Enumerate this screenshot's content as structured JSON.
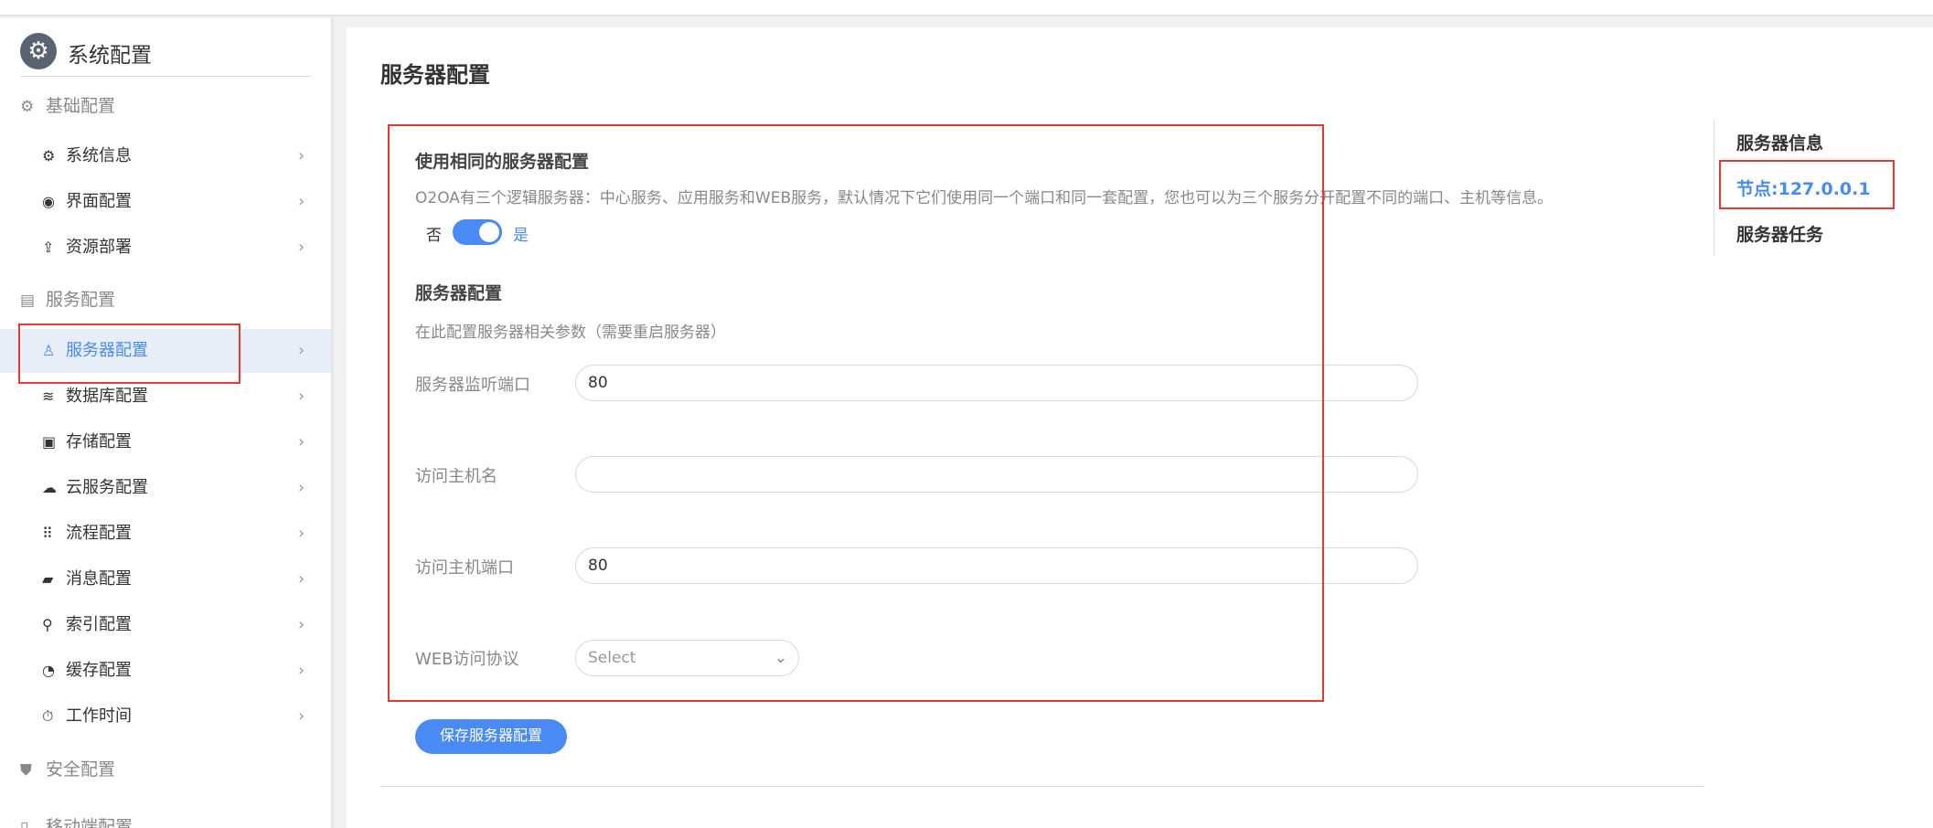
{
  "sidebar": {
    "title": "系统配置",
    "groups": {
      "basic": "基础配置",
      "service": "服务配置",
      "security": "安全配置",
      "mobile": "移动端配置"
    },
    "items": [
      {
        "label": "系统信息",
        "icon": "gear-icon"
      },
      {
        "label": "界面配置",
        "icon": "palette-icon"
      },
      {
        "label": "资源部署",
        "icon": "deploy-icon"
      },
      {
        "label": "服务器配置",
        "icon": "server-user-icon",
        "active": true
      },
      {
        "label": "数据库配置",
        "icon": "database-icon"
      },
      {
        "label": "存储配置",
        "icon": "storage-icon"
      },
      {
        "label": "云服务配置",
        "icon": "cloud-icon"
      },
      {
        "label": "流程配置",
        "icon": "flow-icon"
      },
      {
        "label": "消息配置",
        "icon": "message-icon"
      },
      {
        "label": "索引配置",
        "icon": "search-icon"
      },
      {
        "label": "缓存配置",
        "icon": "cache-icon"
      },
      {
        "label": "工作时间",
        "icon": "timer-icon"
      }
    ]
  },
  "main": {
    "title": "服务器配置",
    "same_config": {
      "title": "使用相同的服务器配置",
      "desc": "O2OA有三个逻辑服务器：中心服务、应用服务和WEB服务，默认情况下它们使用同一个端口和同一套配置，您也可以为三个服务分开配置不同的端口、主机等信息。",
      "off_label": "否",
      "on_label": "是",
      "enabled": true
    },
    "server_config": {
      "title": "服务器配置",
      "desc": "在此配置服务器相关参数（需要重启服务器）",
      "fields": {
        "port_label": "服务器监听端口",
        "port_value": "80",
        "host_label": "访问主机名",
        "host_value": "",
        "hostport_label": "访问主机端口",
        "hostport_value": "80",
        "protocol_label": "WEB访问协议",
        "protocol_placeholder": "Select"
      }
    },
    "save_label": "保存服务器配置"
  },
  "rightnav": {
    "info": "服务器信息",
    "node": "节点:127.0.0.1",
    "tasks": "服务器任务"
  },
  "colors": {
    "accent": "#4a8af4",
    "highlight": "#e53935"
  }
}
